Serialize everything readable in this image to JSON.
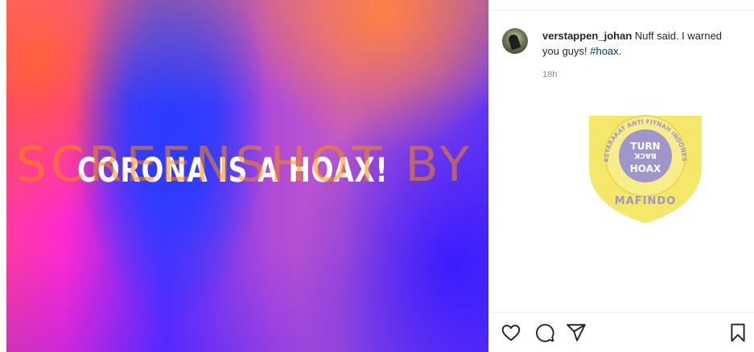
{
  "post": {
    "image_text": "CORONA IS A HOAX!",
    "watermark": "SCREENSHOT BY",
    "username": "verstappen_johan",
    "caption_text": "Nuff said. I warned you guys!",
    "hashtag": "#hoax",
    "caption_end": ".",
    "timestamp": "18h"
  },
  "logo": {
    "line1": "TURN",
    "line2": "BACK",
    "line3": "HOAX",
    "arc_text": "MASYARAKAT ANTI FITNAH INDONESIA",
    "name": "MAFINDO"
  },
  "actions": {
    "like": "heart-icon",
    "comment": "comment-icon",
    "share": "paper-plane-icon",
    "save": "bookmark-icon"
  },
  "colors": {
    "hashtag": "#00376b",
    "muted": "#8e8e8e",
    "text": "#262626",
    "logo_yellow": "#f4e24a",
    "logo_purple": "#8b7fc4"
  }
}
